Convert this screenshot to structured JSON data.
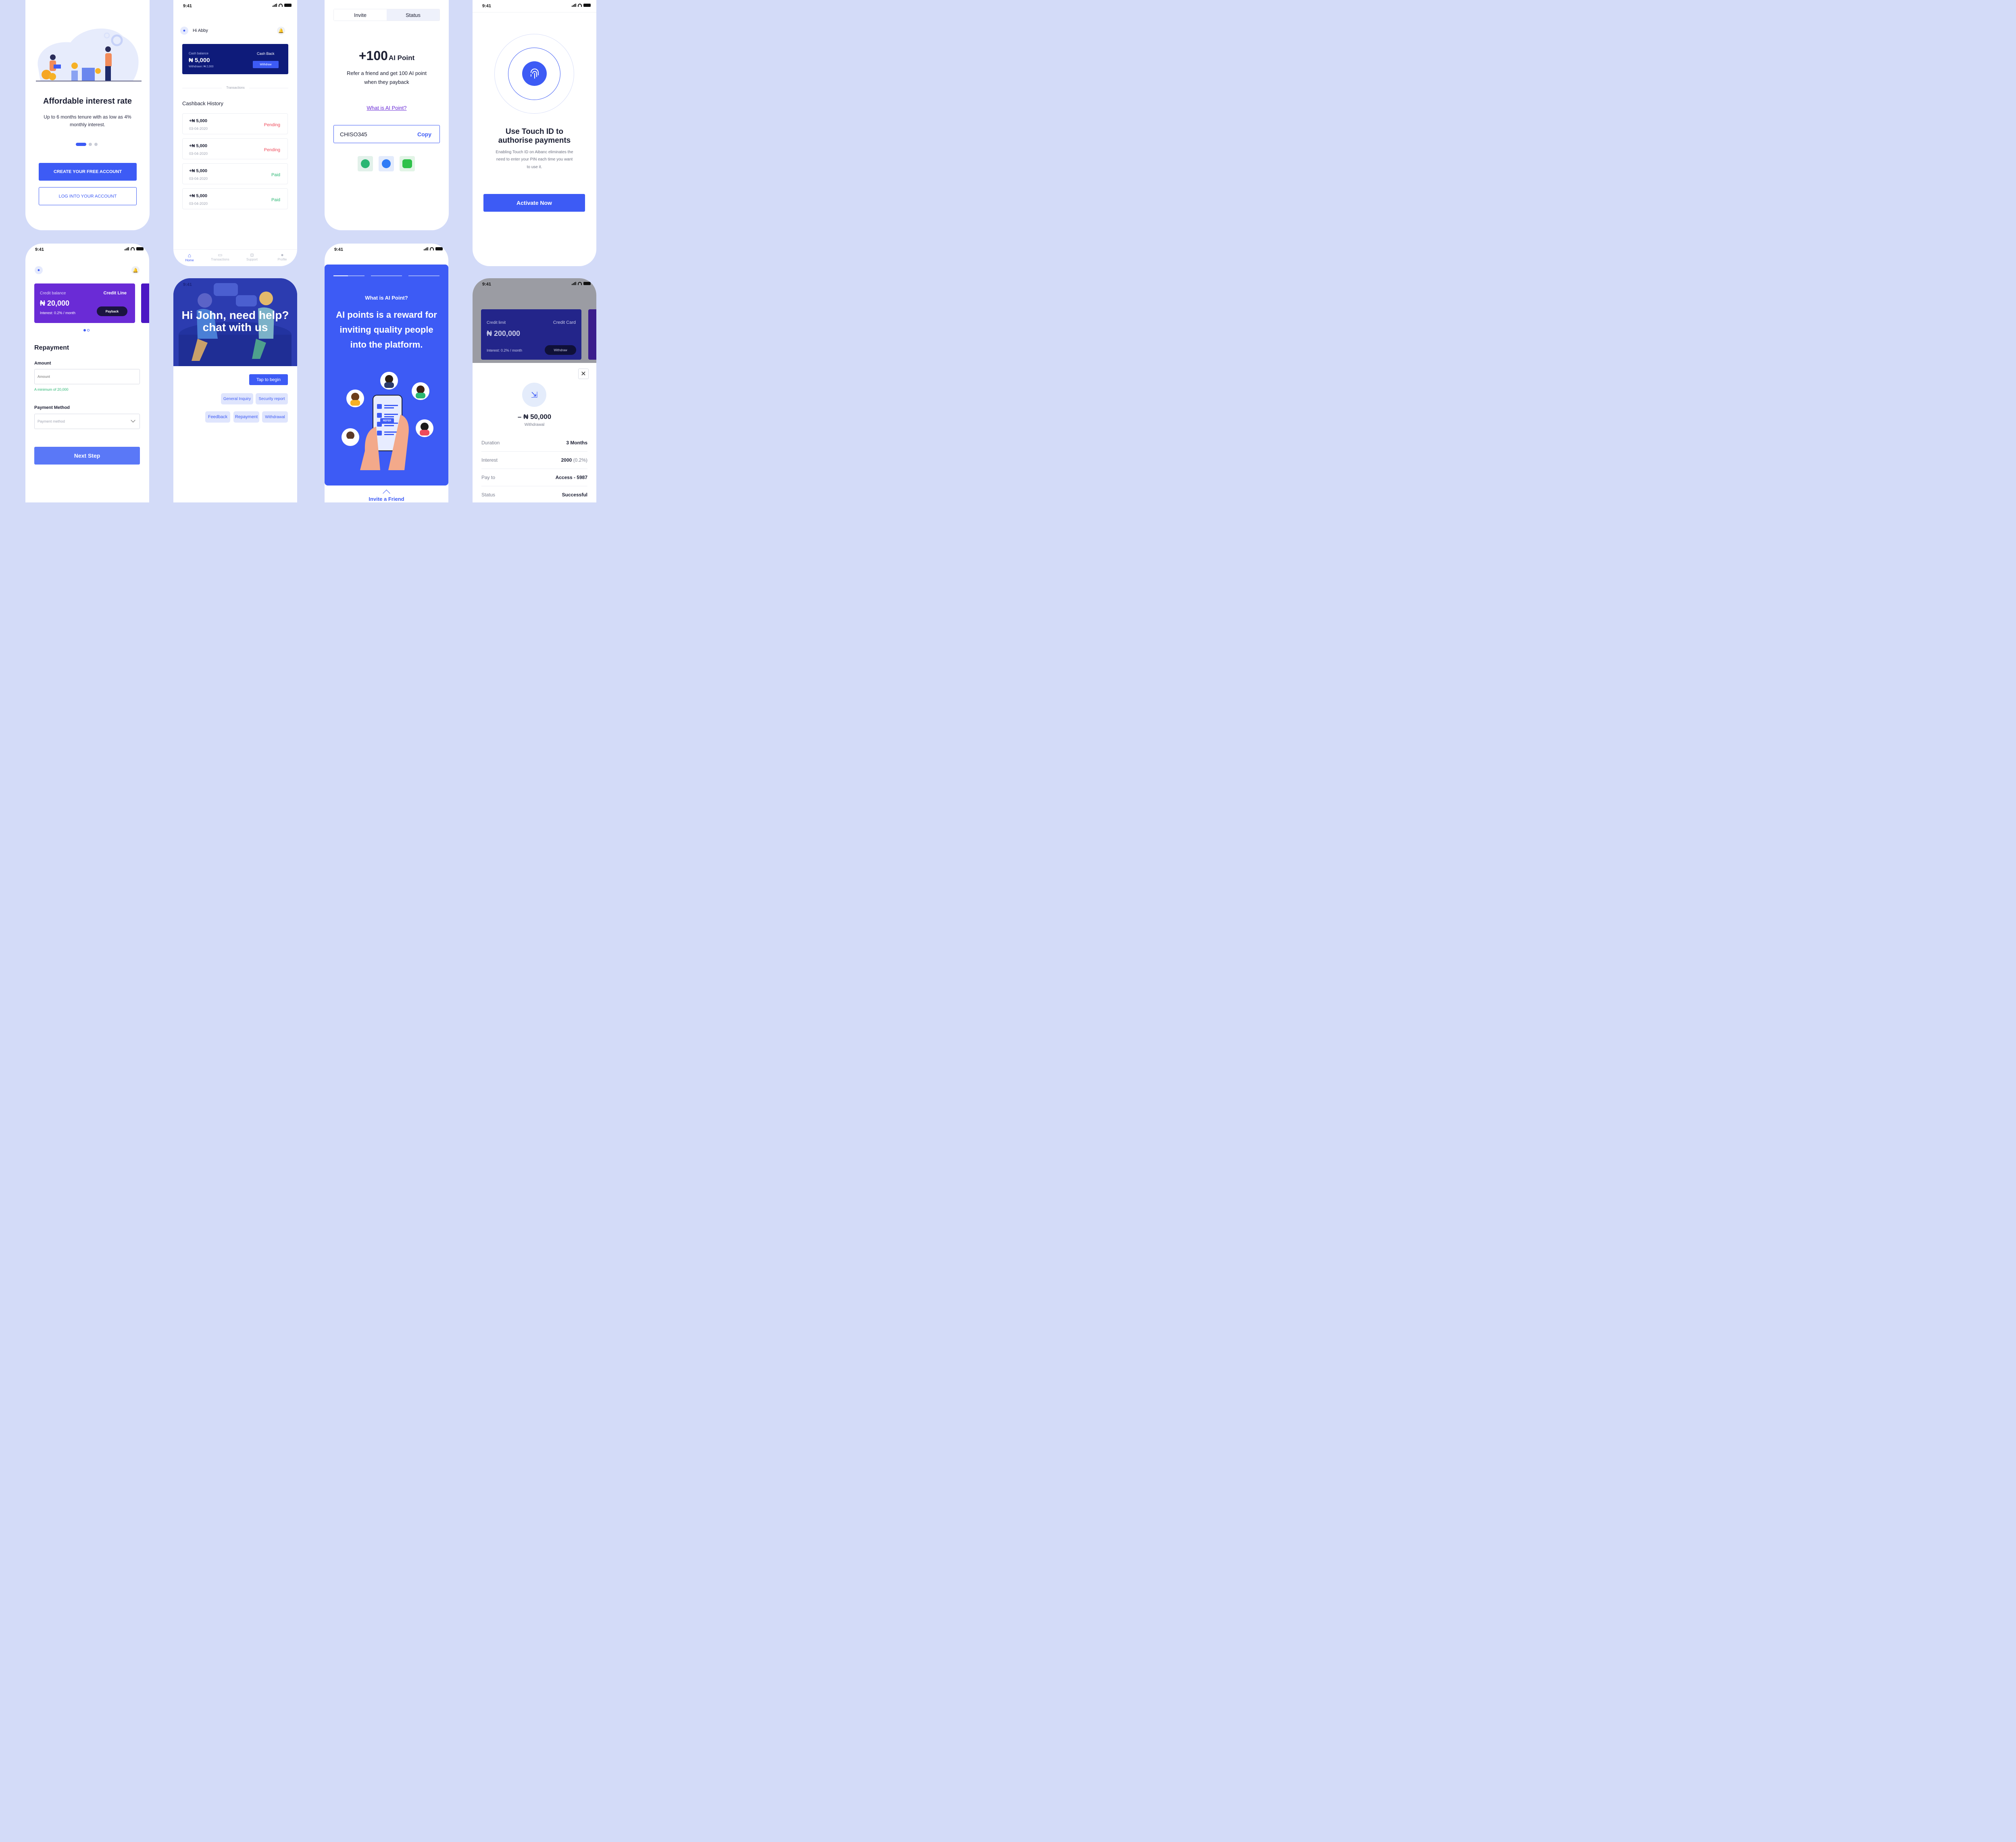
{
  "status_time": "9:41",
  "colors": {
    "accent": "#3d5bf5",
    "background": "#d3dbf8",
    "navy": "#0e1b7a",
    "purple": "#6a2bd6",
    "pending": "#ef4b5b",
    "paid": "#2bb673"
  },
  "onboarding": {
    "title": "Affordable interest rate",
    "subtitle": "Up to 6 months tenure with as low as 4% monthly interest.",
    "create_button": "CREATE YOUR FREE ACCOUNT",
    "login_button": "LOG INTO YOUR ACCOUNT"
  },
  "cashback": {
    "greeting": "Hi Abby",
    "card": {
      "balance_label": "Cash balance",
      "balance": "₦ 5,000",
      "withdrawn": "Withdrawn: ₦ 2,000",
      "type": "Cash Back",
      "withdraw_button": "Withdraw"
    },
    "divider_label": "Transactions",
    "history_title": "Cashback History",
    "rows": [
      {
        "amount": "+₦ 5,000",
        "date": "03-04-2020",
        "status": "Pending"
      },
      {
        "amount": "+₦ 5,000",
        "date": "03-04-2020",
        "status": "Pending"
      },
      {
        "amount": "+₦ 5,000",
        "date": "03-04-2020",
        "status": "Paid"
      },
      {
        "amount": "+₦ 5,000",
        "date": "03-04-2020",
        "status": "Paid"
      }
    ],
    "nav": [
      "Home",
      "Transactions",
      "Support",
      "Profile"
    ]
  },
  "invite": {
    "tabs": [
      "Invite",
      "Status"
    ],
    "points_big": "+100",
    "points_unit": "AI Point",
    "description_line1": "Refer a friend and get 100 AI point",
    "description_line2": "when they payback",
    "link": "What is AI Point?",
    "code": "CHISO345",
    "copy": "Copy",
    "share_icons": [
      "whatsapp-icon",
      "messenger-icon",
      "message-icon"
    ]
  },
  "touchid": {
    "title_line1": "Use Touch ID to",
    "title_line2": "authorise payments",
    "desc_line1": "Enabling Touch ID on Aibanc eliminates the",
    "desc_line2": "need to enter your PIN each time you want",
    "desc_line3": "to use it.",
    "button": "Activate Now"
  },
  "repayment": {
    "card": {
      "label": "Credit balance",
      "type": "Credit Line",
      "amount": "₦ 20,000",
      "interest": "Interest: 0.2% / month",
      "button": "Payback"
    },
    "title": "Repayment",
    "amount_label": "Amount",
    "amount_placeholder": "Amount",
    "amount_hint": "A minimum of 20,000",
    "method_label": "Payment Method",
    "method_placeholder": "Payment method",
    "next_button": "Next Step"
  },
  "support": {
    "time": "9:41",
    "hero_line1": "Hi John, need help?",
    "hero_line2": "chat with us",
    "tap_button": "Tap to begin",
    "chips_row1": [
      "General Inquiry",
      "Security report"
    ],
    "chips_row2": [
      "Feedback",
      "Repayment",
      "Withdrawal"
    ]
  },
  "aipoint": {
    "heading": "What is AI Point?",
    "line1": "AI points is a reward for",
    "line2": "inviting quality people",
    "line3": "into the platform.",
    "refer_badge": "REFER",
    "footer": "Invite a Friend"
  },
  "withdraw_detail": {
    "card": {
      "label": "Credit limit",
      "type": "Credit Card",
      "amount": "₦ 200,000",
      "interest": "Interest: 0.2% / month",
      "button": "Withdraw"
    },
    "amount": "– ₦ 50,000",
    "amount_label": "Withdrawal",
    "rows": [
      {
        "label": "Duration",
        "value": "3 Months"
      },
      {
        "label": "Interest",
        "value": "2000",
        "extra": "(0.2%)"
      },
      {
        "label": "Pay to",
        "value": "Access - 5987"
      },
      {
        "label": "Status",
        "value": "Successful"
      }
    ]
  }
}
